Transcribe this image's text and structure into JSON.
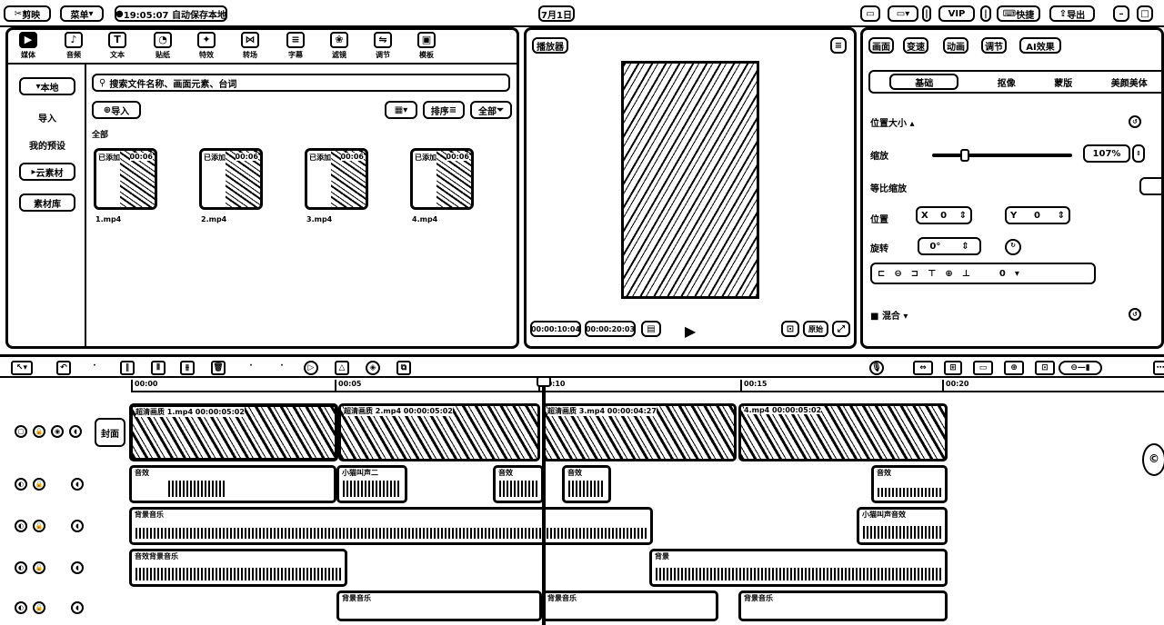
{
  "topbar": {
    "app_name": "剪映",
    "menu": "菜单",
    "autosave": "19:05:07 自动保存本地",
    "project_title": "7月1日",
    "vip": "VIP",
    "shortcut": "快捷",
    "export": "导出"
  },
  "media": {
    "tabs": [
      "媒体",
      "音频",
      "文本",
      "贴纸",
      "特效",
      "转场",
      "字幕",
      "滤镜",
      "调节",
      "模板"
    ],
    "sidebar": [
      "本地",
      "导入",
      "我的预设",
      "云素材",
      "素材库"
    ],
    "search_placeholder": "搜索文件名称、画面元素、台词",
    "import_label": "导入",
    "sort_label": "排序",
    "filter_label": "全部",
    "all_label": "全部",
    "clips": [
      {
        "tag": "已添加",
        "duration": "00:06",
        "name": "1.mp4"
      },
      {
        "tag": "已添加",
        "duration": "00:06",
        "name": "2.mp4"
      },
      {
        "tag": "已添加",
        "duration": "00:06",
        "name": "3.mp4"
      },
      {
        "tag": "已添加",
        "duration": "00:06",
        "name": "4.mp4"
      }
    ]
  },
  "player": {
    "title": "播放器",
    "current_time": "00:00:10:04",
    "total_time": "00:00:20:03",
    "ratio_label": "原始"
  },
  "inspector": {
    "tabs": [
      "画面",
      "变速",
      "动画",
      "调节",
      "AI效果"
    ],
    "subtabs": [
      "基础",
      "抠像",
      "蒙版",
      "美颜美体"
    ],
    "position_size": "位置大小",
    "scale_label": "缩放",
    "scale_value": "107%",
    "scale_level": 0.22,
    "uniform_scale": "等比缩放",
    "position_label": "位置",
    "x_label": "X",
    "x_value": "0",
    "y_label": "Y",
    "y_value": "0",
    "rotation_label": "旋转",
    "rotation_value": "0°",
    "align_value": "0",
    "blend_label": "混合"
  },
  "timeline": {
    "ticks": [
      "00:00",
      "00:05",
      "00:10",
      "00:15",
      "00:20"
    ],
    "cover_label": "封面",
    "video_clips": [
      {
        "label": "超清画质  1.mp4  00:00:05:02"
      },
      {
        "label": "超清画质  2.mp4  00:00:05:02"
      },
      {
        "label": "超清画质  3.mp4  00:00:04:27"
      },
      {
        "label": "4.mp4  00:00:05:02"
      }
    ],
    "audio_row1": [
      {
        "label": "音效"
      },
      {
        "label": "小猫叫声二"
      },
      {
        "label": "音效"
      },
      {
        "label": "音效"
      },
      {
        "label": "音效"
      }
    ],
    "audio_row2": [
      {
        "label": "背景音乐"
      },
      {
        "label": "小猫叫声音效"
      }
    ],
    "audio_row3": [
      {
        "label": "音效背景音乐"
      },
      {
        "label": "背景"
      }
    ],
    "audio_row4": [
      {
        "label": "背景音乐"
      },
      {
        "label": "背景音乐"
      },
      {
        "label": "背景音乐"
      }
    ]
  }
}
